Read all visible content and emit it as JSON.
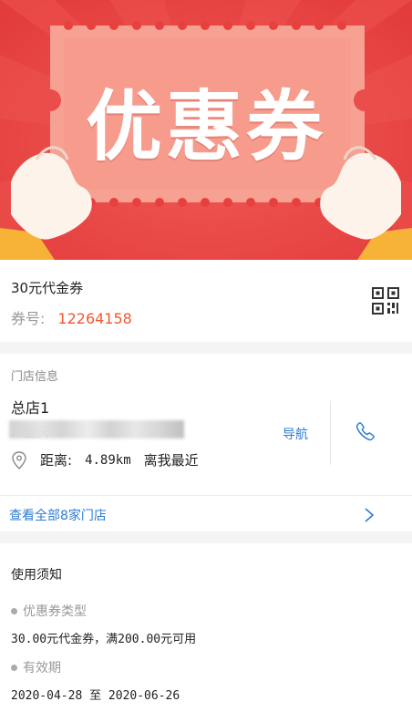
{
  "banner": {
    "title": "优惠券"
  },
  "coupon": {
    "name": "30元代金券",
    "number_label": "券号:",
    "number": "12264158"
  },
  "store": {
    "section_title": "门店信息",
    "name": "总店1",
    "address": "...重庆",
    "distance_label": "距离:",
    "distance_value": "4.89km",
    "distance_note": "离我最近",
    "nav_label": "导航",
    "all_stores": "查看全部8家门店"
  },
  "notice": {
    "title": "使用须知",
    "type_label": "优惠券类型",
    "type_value": "30.00元代金券，满200.00元可用",
    "validity_label": "有效期",
    "validity_value": "2020-04-28 至 2020-06-26"
  },
  "colors": {
    "banner_red": "#e8403f",
    "accent_orange": "#f1572f",
    "link_blue": "#2c7dd0"
  }
}
